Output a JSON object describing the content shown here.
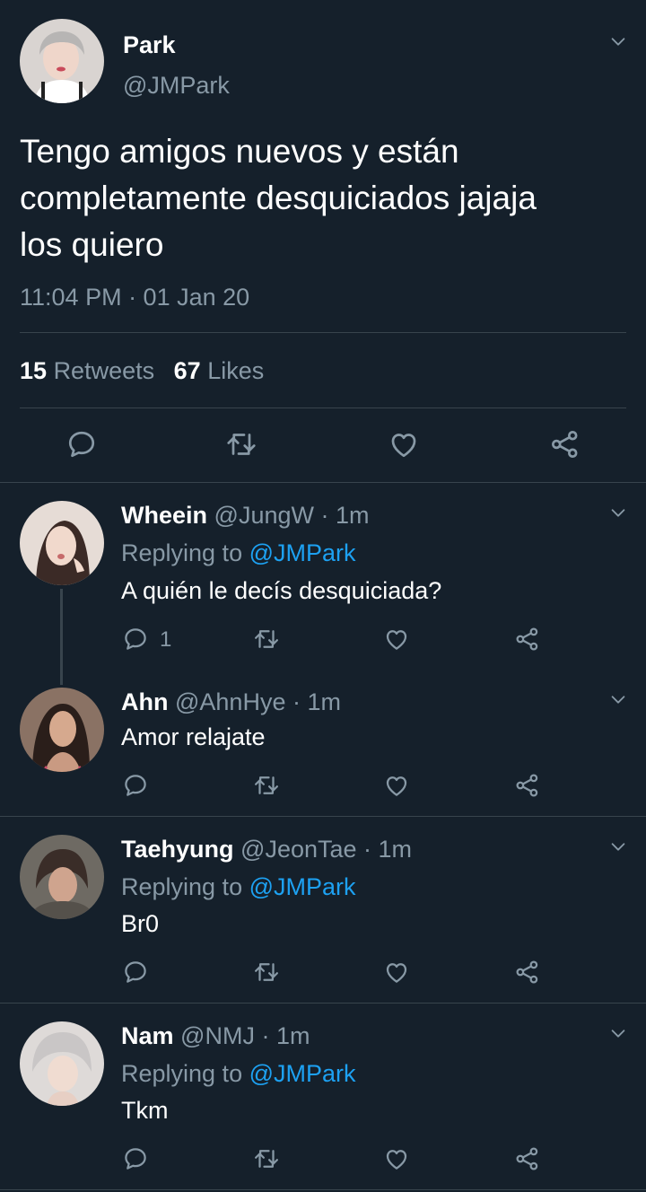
{
  "main_tweet": {
    "name": "Park",
    "handle": "@JMPark",
    "text_lines": [
      "Tengo amigos nuevos y están",
      "completamente desquiciados jajaja",
      "los quiero"
    ],
    "timestamp": "11:04 PM · 01 Jan 20",
    "retweets_count": "15",
    "retweets_label": "Retweets",
    "likes_count": "67",
    "likes_label": "Likes"
  },
  "replies": [
    {
      "name": "Wheein",
      "handle": "@JungW",
      "time": "· 1m",
      "replying_prefix": "Replying to",
      "replying_to": "@JMPark",
      "text": "A quién le decís desquiciada?",
      "reply_count": "1"
    },
    {
      "name": "Ahn",
      "handle": "@AhnHye",
      "time": "· 1m",
      "text": "Amor relajate"
    },
    {
      "name": "Taehyung",
      "handle": "@JeonTae",
      "time": "· 1m",
      "replying_prefix": "Replying to",
      "replying_to": "@JMPark",
      "text": "Br0"
    },
    {
      "name": "Nam",
      "handle": "@NMJ",
      "time": "· 1m",
      "replying_prefix": "Replying to",
      "replying_to": "@JMPark",
      "text": "Tkm"
    }
  ],
  "colors": {
    "background": "#15202b",
    "accent": "#1da1f2",
    "muted": "#8899a6",
    "divider": "#38444d"
  },
  "icons": [
    "chevron-down-icon",
    "reply-icon",
    "retweet-icon",
    "like-icon",
    "share-icon"
  ]
}
